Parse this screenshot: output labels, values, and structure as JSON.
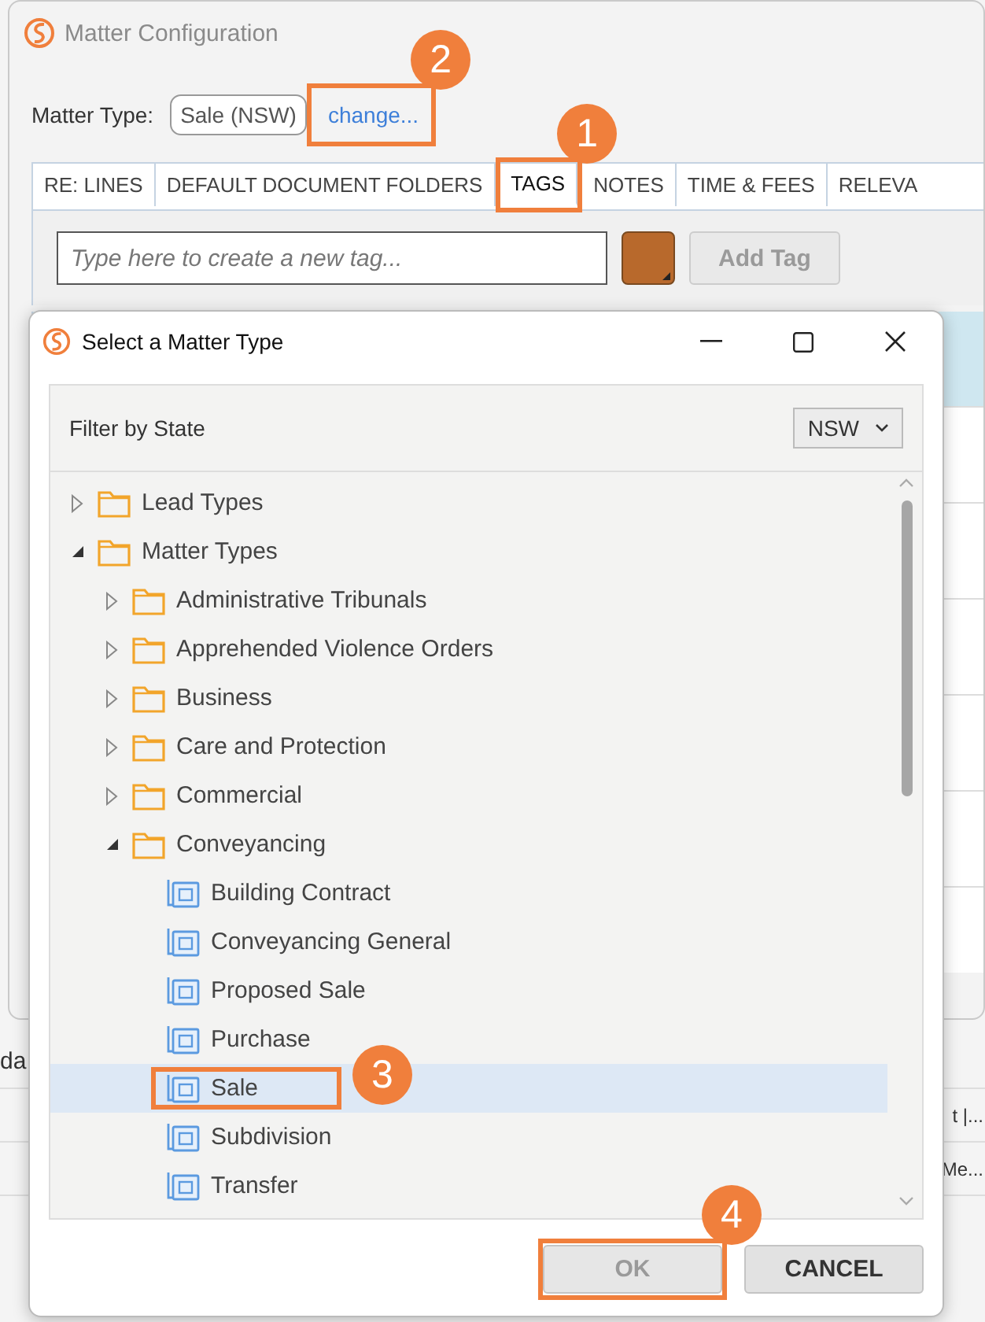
{
  "main_window": {
    "title": "Matter Configuration",
    "matter_type_label": "Matter Type:",
    "matter_type_value": "Sale (NSW)",
    "change_link": {
      "text": "change...",
      "callout": "2"
    },
    "tabs": [
      {
        "label": "RE: LINES",
        "selected": false
      },
      {
        "label": "DEFAULT DOCUMENT FOLDERS",
        "selected": false
      },
      {
        "label": "TAGS",
        "selected": true,
        "callout": "1"
      },
      {
        "label": "NOTES",
        "selected": false
      },
      {
        "label": "TIME & FEES",
        "selected": false
      },
      {
        "label": "RELEVA",
        "selected": false
      }
    ],
    "tag_input": {
      "placeholder": "Type here to create a new tag..."
    },
    "add_tag_button": {
      "label": "Add Tag",
      "disabled": true
    }
  },
  "background_rows": [
    {
      "text": "da",
      "kind": "start"
    },
    {
      "text": "t |...",
      "kind": "end"
    },
    {
      "text": "Me...",
      "kind": "end"
    }
  ],
  "dialog": {
    "title": "Select a Matter Type",
    "filter_label": "Filter by State",
    "state": "NSW",
    "tree": [
      {
        "label": "Lead Types",
        "kind": "folder",
        "expanded": false,
        "selected": false
      },
      {
        "label": "Matter Types",
        "kind": "folder",
        "expanded": true,
        "selected": false,
        "children": [
          {
            "label": "Administrative Tribunals",
            "kind": "folder",
            "expanded": false,
            "selected": false
          },
          {
            "label": "Apprehended Violence Orders",
            "kind": "folder",
            "expanded": false,
            "selected": false
          },
          {
            "label": "Business",
            "kind": "folder",
            "expanded": false,
            "selected": false
          },
          {
            "label": "Care and Protection",
            "kind": "folder",
            "expanded": false,
            "selected": false
          },
          {
            "label": "Commercial",
            "kind": "folder",
            "expanded": false,
            "selected": false
          },
          {
            "label": "Conveyancing",
            "kind": "folder",
            "expanded": true,
            "selected": false,
            "children": [
              {
                "label": "Building Contract",
                "kind": "matter",
                "selected": false
              },
              {
                "label": "Conveyancing General",
                "kind": "matter",
                "selected": false
              },
              {
                "label": "Proposed Sale",
                "kind": "matter",
                "selected": false
              },
              {
                "label": "Purchase",
                "kind": "matter",
                "selected": false
              },
              {
                "label": "Sale",
                "kind": "matter",
                "selected": true,
                "callout": "3"
              },
              {
                "label": "Subdivision",
                "kind": "matter",
                "selected": false
              },
              {
                "label": "Transfer",
                "kind": "matter",
                "selected": false
              }
            ]
          }
        ]
      }
    ],
    "buttons": [
      {
        "label": "OK",
        "disabled": true,
        "callout": "4"
      },
      {
        "label": "CANCEL",
        "disabled": false
      }
    ]
  }
}
